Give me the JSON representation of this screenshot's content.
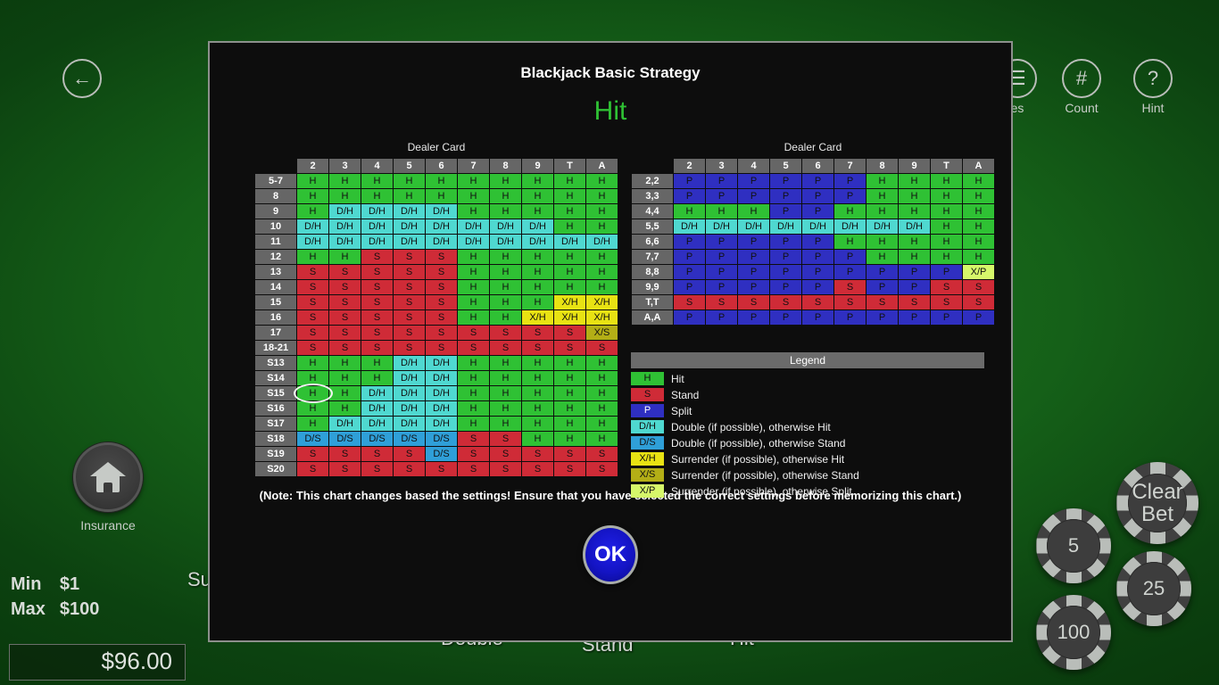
{
  "app": {
    "background_buttons": [
      {
        "name": "back",
        "glyph": "←",
        "caption": ""
      },
      {
        "name": "rules",
        "glyph": "☰",
        "caption": "es"
      },
      {
        "name": "count",
        "glyph": "#",
        "caption": "Count"
      },
      {
        "name": "hint",
        "glyph": "?",
        "caption": "Hint"
      }
    ],
    "insurance_label": "Insurance",
    "surrender_partial_label": "Su",
    "limits": {
      "min_label": "Min",
      "min_value": "$1",
      "max_label": "Max",
      "max_value": "$100"
    },
    "balance": "$96.00",
    "action_buttons": [
      "Double",
      "Stand",
      "Hit"
    ],
    "chips": [
      {
        "label": "Clear\nBet",
        "line1": "Clear",
        "line2": "Bet"
      },
      {
        "label": "5"
      },
      {
        "label": "25"
      },
      {
        "label": "100"
      }
    ]
  },
  "dialog": {
    "title": "Blackjack Basic Strategy",
    "recommended_action": "Hit",
    "recommended_action_color": "#2fc134",
    "dealer_card_label": "Dealer Card",
    "note": "(Note: This chart changes based the settings! Ensure that you have selected the correct settings before memorizing this chart.)",
    "ok_label": "OK",
    "highlight": {
      "table": "hard_soft",
      "row": "S15",
      "column": "2"
    }
  },
  "chart_data": [
    {
      "type": "table",
      "title": "Dealer Card",
      "name": "hard-and-soft-totals",
      "columns": [
        "2",
        "3",
        "4",
        "5",
        "6",
        "7",
        "8",
        "9",
        "T",
        "A"
      ],
      "rows": [
        {
          "label": "5-7",
          "cells": [
            "H",
            "H",
            "H",
            "H",
            "H",
            "H",
            "H",
            "H",
            "H",
            "H"
          ]
        },
        {
          "label": "8",
          "cells": [
            "H",
            "H",
            "H",
            "H",
            "H",
            "H",
            "H",
            "H",
            "H",
            "H"
          ]
        },
        {
          "label": "9",
          "cells": [
            "H",
            "D/H",
            "D/H",
            "D/H",
            "D/H",
            "H",
            "H",
            "H",
            "H",
            "H"
          ]
        },
        {
          "label": "10",
          "cells": [
            "D/H",
            "D/H",
            "D/H",
            "D/H",
            "D/H",
            "D/H",
            "D/H",
            "D/H",
            "H",
            "H"
          ]
        },
        {
          "label": "11",
          "cells": [
            "D/H",
            "D/H",
            "D/H",
            "D/H",
            "D/H",
            "D/H",
            "D/H",
            "D/H",
            "D/H",
            "D/H"
          ]
        },
        {
          "label": "12",
          "cells": [
            "H",
            "H",
            "S",
            "S",
            "S",
            "H",
            "H",
            "H",
            "H",
            "H"
          ]
        },
        {
          "label": "13",
          "cells": [
            "S",
            "S",
            "S",
            "S",
            "S",
            "H",
            "H",
            "H",
            "H",
            "H"
          ]
        },
        {
          "label": "14",
          "cells": [
            "S",
            "S",
            "S",
            "S",
            "S",
            "H",
            "H",
            "H",
            "H",
            "H"
          ]
        },
        {
          "label": "15",
          "cells": [
            "S",
            "S",
            "S",
            "S",
            "S",
            "H",
            "H",
            "H",
            "X/H",
            "X/H"
          ]
        },
        {
          "label": "16",
          "cells": [
            "S",
            "S",
            "S",
            "S",
            "S",
            "H",
            "H",
            "X/H",
            "X/H",
            "X/H"
          ]
        },
        {
          "label": "17",
          "cells": [
            "S",
            "S",
            "S",
            "S",
            "S",
            "S",
            "S",
            "S",
            "S",
            "X/S"
          ]
        },
        {
          "label": "18-21",
          "cells": [
            "S",
            "S",
            "S",
            "S",
            "S",
            "S",
            "S",
            "S",
            "S",
            "S"
          ]
        },
        {
          "label": "S13",
          "cells": [
            "H",
            "H",
            "H",
            "D/H",
            "D/H",
            "H",
            "H",
            "H",
            "H",
            "H"
          ]
        },
        {
          "label": "S14",
          "cells": [
            "H",
            "H",
            "H",
            "D/H",
            "D/H",
            "H",
            "H",
            "H",
            "H",
            "H"
          ]
        },
        {
          "label": "S15",
          "cells": [
            "H",
            "H",
            "D/H",
            "D/H",
            "D/H",
            "H",
            "H",
            "H",
            "H",
            "H"
          ]
        },
        {
          "label": "S16",
          "cells": [
            "H",
            "H",
            "D/H",
            "D/H",
            "D/H",
            "H",
            "H",
            "H",
            "H",
            "H"
          ]
        },
        {
          "label": "S17",
          "cells": [
            "H",
            "D/H",
            "D/H",
            "D/H",
            "D/H",
            "H",
            "H",
            "H",
            "H",
            "H"
          ]
        },
        {
          "label": "S18",
          "cells": [
            "D/S",
            "D/S",
            "D/S",
            "D/S",
            "D/S",
            "S",
            "S",
            "H",
            "H",
            "H"
          ]
        },
        {
          "label": "S19",
          "cells": [
            "S",
            "S",
            "S",
            "S",
            "D/S",
            "S",
            "S",
            "S",
            "S",
            "S"
          ]
        },
        {
          "label": "S20",
          "cells": [
            "S",
            "S",
            "S",
            "S",
            "S",
            "S",
            "S",
            "S",
            "S",
            "S"
          ]
        }
      ]
    },
    {
      "type": "table",
      "title": "Dealer Card",
      "name": "pair-splitting",
      "columns": [
        "2",
        "3",
        "4",
        "5",
        "6",
        "7",
        "8",
        "9",
        "T",
        "A"
      ],
      "rows": [
        {
          "label": "2,2",
          "cells": [
            "P",
            "P",
            "P",
            "P",
            "P",
            "P",
            "H",
            "H",
            "H",
            "H"
          ]
        },
        {
          "label": "3,3",
          "cells": [
            "P",
            "P",
            "P",
            "P",
            "P",
            "P",
            "H",
            "H",
            "H",
            "H"
          ]
        },
        {
          "label": "4,4",
          "cells": [
            "H",
            "H",
            "H",
            "P",
            "P",
            "H",
            "H",
            "H",
            "H",
            "H"
          ]
        },
        {
          "label": "5,5",
          "cells": [
            "D/H",
            "D/H",
            "D/H",
            "D/H",
            "D/H",
            "D/H",
            "D/H",
            "D/H",
            "H",
            "H"
          ]
        },
        {
          "label": "6,6",
          "cells": [
            "P",
            "P",
            "P",
            "P",
            "P",
            "H",
            "H",
            "H",
            "H",
            "H"
          ]
        },
        {
          "label": "7,7",
          "cells": [
            "P",
            "P",
            "P",
            "P",
            "P",
            "P",
            "H",
            "H",
            "H",
            "H"
          ]
        },
        {
          "label": "8,8",
          "cells": [
            "P",
            "P",
            "P",
            "P",
            "P",
            "P",
            "P",
            "P",
            "P",
            "X/P"
          ]
        },
        {
          "label": "9,9",
          "cells": [
            "P",
            "P",
            "P",
            "P",
            "P",
            "S",
            "P",
            "P",
            "S",
            "S"
          ]
        },
        {
          "label": "T,T",
          "cells": [
            "S",
            "S",
            "S",
            "S",
            "S",
            "S",
            "S",
            "S",
            "S",
            "S"
          ]
        },
        {
          "label": "A,A",
          "cells": [
            "P",
            "P",
            "P",
            "P",
            "P",
            "P",
            "P",
            "P",
            "P",
            "P"
          ]
        }
      ]
    }
  ],
  "legend": {
    "header": "Legend",
    "items": [
      {
        "code": "H",
        "text": "Hit",
        "color": "#2fc134"
      },
      {
        "code": "S",
        "text": "Stand",
        "color": "#cf2b37"
      },
      {
        "code": "P",
        "text": "Split",
        "color": "#2f2fc1"
      },
      {
        "code": "D/H",
        "text": "Double (if possible), otherwise Hit",
        "color": "#4fd8d0"
      },
      {
        "code": "D/S",
        "text": "Double (if possible), otherwise Stand",
        "color": "#2f9fd8"
      },
      {
        "code": "X/H",
        "text": "Surrender (if possible), otherwise Hit",
        "color": "#e8e213"
      },
      {
        "code": "X/S",
        "text": "Surrender (if possible), otherwise Stand",
        "color": "#b3ae16"
      },
      {
        "code": "X/P",
        "text": "Surrender (if possible), otherwise Split",
        "color": "#d6f76a"
      }
    ]
  }
}
